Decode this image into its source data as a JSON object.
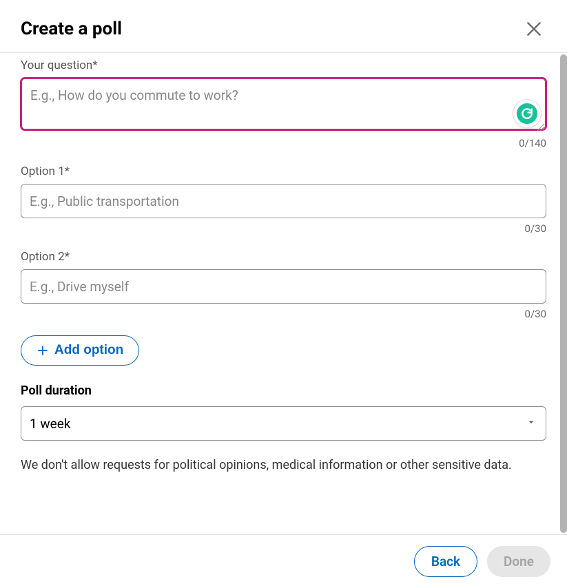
{
  "header": {
    "title": "Create a poll"
  },
  "question": {
    "label": "Your question*",
    "placeholder": "E.g., How do you commute to work?",
    "counter": "0/140"
  },
  "options": [
    {
      "label": "Option 1*",
      "placeholder": "E.g., Public transportation",
      "counter": "0/30"
    },
    {
      "label": "Option 2*",
      "placeholder": "E.g., Drive myself",
      "counter": "0/30"
    }
  ],
  "addOption": {
    "label": "Add option"
  },
  "duration": {
    "label": "Poll duration",
    "value": "1 week"
  },
  "disclaimer": "We don't allow requests for political opinions, medical information or other sensitive data.",
  "footer": {
    "back": "Back",
    "done": "Done"
  }
}
